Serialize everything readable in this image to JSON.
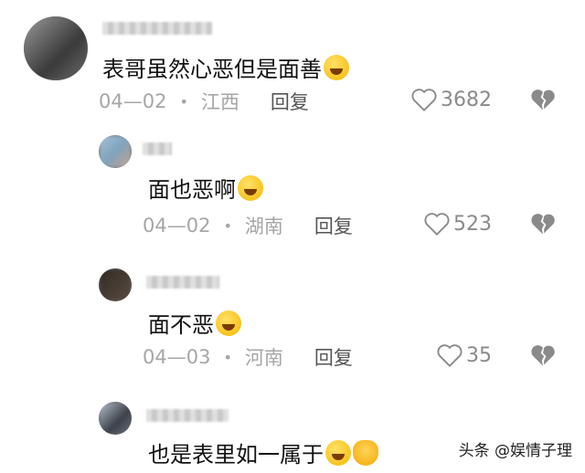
{
  "comments": [
    {
      "text": "表哥虽然心恶但是面善",
      "emoji": "winking-face-emoji",
      "date": "04—02",
      "location": "江西",
      "reply_label": "回复",
      "likes": "3682"
    },
    {
      "text": "面也恶啊",
      "emoji": "laughing-face-emoji",
      "date": "04—02",
      "location": "湖南",
      "reply_label": "回复",
      "likes": "523"
    },
    {
      "text": "面不恶",
      "emoji": "grimacing-face-emoji",
      "date": "04—03",
      "location": "河南",
      "reply_label": "回复",
      "likes": "35"
    },
    {
      "text": "也是表里如一属于",
      "emoji": "laughing-face-emoji",
      "emoji2": "ok-hand-emoji"
    }
  ],
  "watermark": "头条 @娱情子理",
  "colors": {
    "meta_gray": "#a6a6a6",
    "icon_gray": "#8a8a8a"
  }
}
